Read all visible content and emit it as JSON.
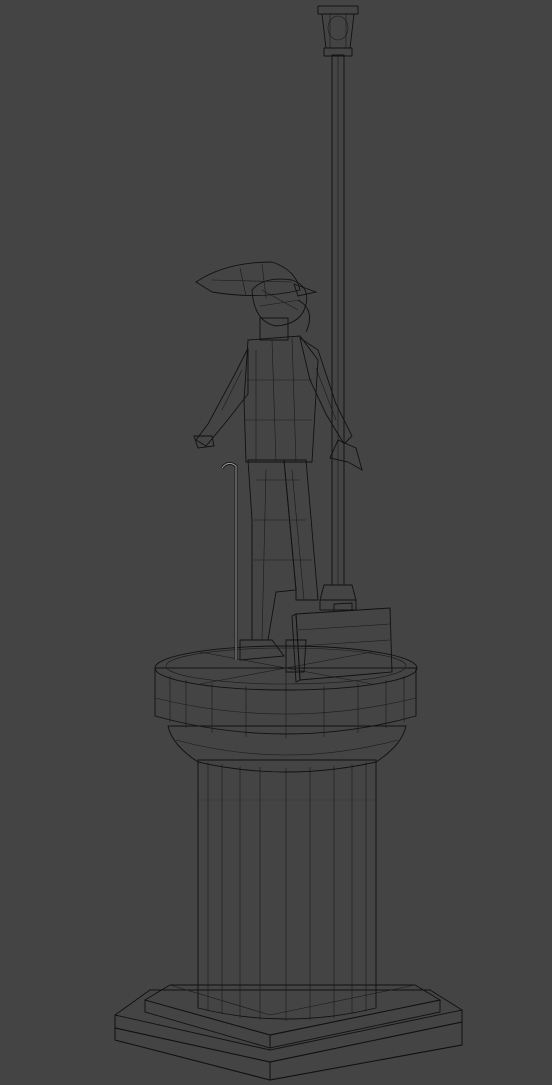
{
  "viewport": {
    "background_color": "#444444",
    "mesh_shading": "grey-shaded-with-wireframe",
    "wire_color": "#111111",
    "surface_light": "#9a9a9a",
    "surface_mid": "#7c7c7c",
    "surface_dark": "#5a5a5a"
  },
  "scene": {
    "objects": [
      "street-lamp",
      "figure-with-bird-head",
      "walking-cane",
      "briefcase",
      "column-capital",
      "column-shaft",
      "plinth-base"
    ]
  }
}
